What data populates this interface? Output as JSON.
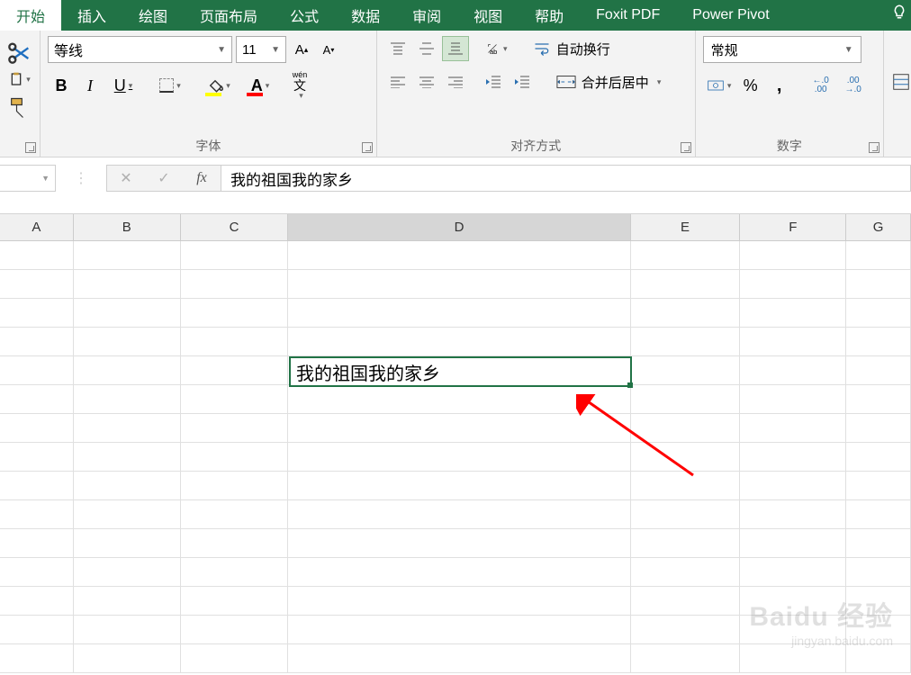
{
  "tabs": {
    "active": "开始",
    "items": [
      "开始",
      "插入",
      "绘图",
      "页面布局",
      "公式",
      "数据",
      "审阅",
      "视图",
      "帮助",
      "Foxit PDF",
      "Power Pivot"
    ]
  },
  "font": {
    "name": "等线",
    "size": "11",
    "group_label": "字体"
  },
  "align": {
    "wrap": "自动换行",
    "merge": "合并后居中",
    "group_label": "对齐方式"
  },
  "number": {
    "format": "常规",
    "group_label": "数字"
  },
  "formula_bar": {
    "value": "我的祖国我的家乡"
  },
  "columns": [
    "A",
    "B",
    "C",
    "D",
    "E",
    "F",
    "G"
  ],
  "selected_cell": {
    "ref": "D5",
    "value": "我的祖国我的家乡"
  },
  "watermark": {
    "brand": "Baidu 经验",
    "url": "jingyan.baidu.com"
  }
}
